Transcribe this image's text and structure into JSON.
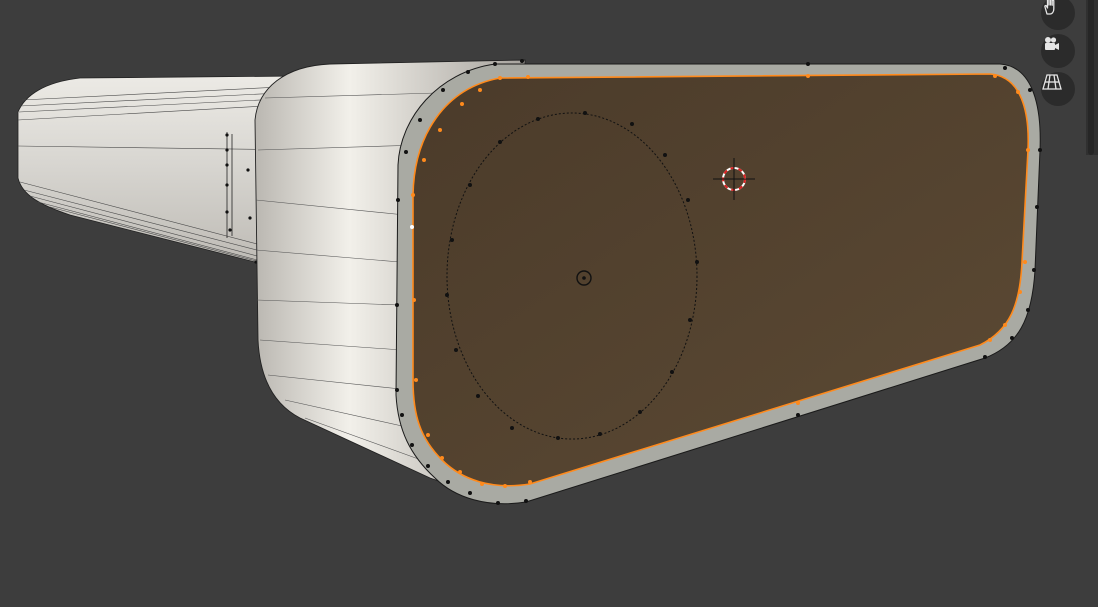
{
  "viewport": {
    "background": "#3d3d3d",
    "mode": "edit-mesh",
    "selected_face_color": "#5a4530",
    "selected_vertex_color": "#ff8a1c",
    "mesh_surface_color": "#c9c7c2"
  },
  "navigation_gizmo": {
    "buttons": [
      {
        "name": "hand-pan-icon"
      },
      {
        "name": "camera-view-icon"
      },
      {
        "name": "perspective-grid-icon"
      }
    ]
  }
}
